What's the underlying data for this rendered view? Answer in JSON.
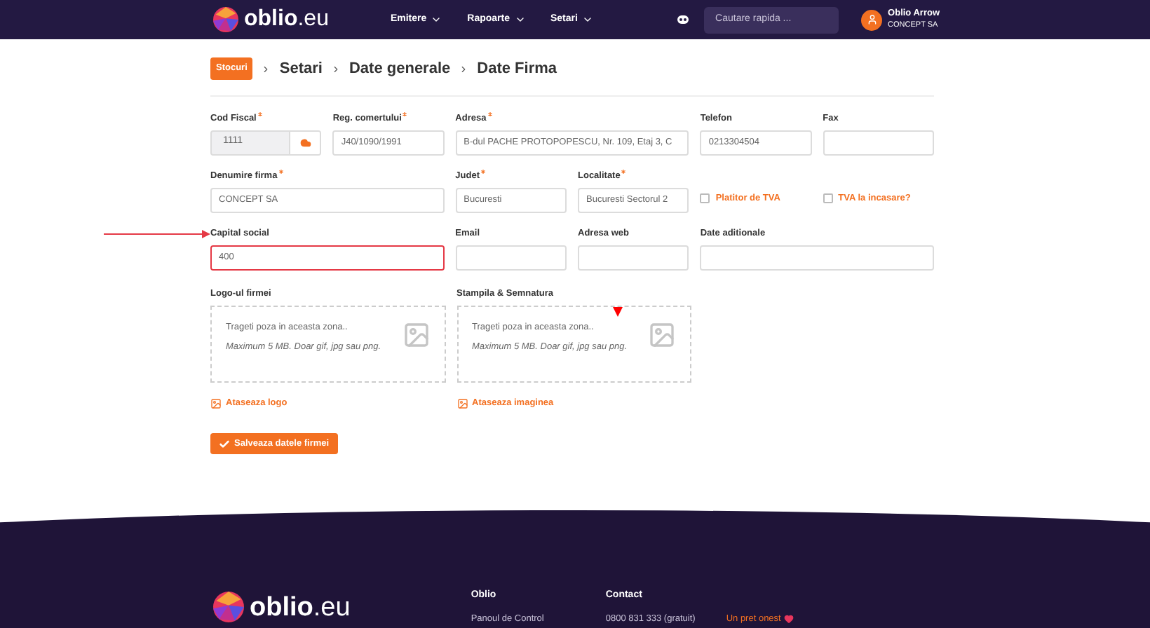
{
  "header": {
    "logo": "oblio.eu",
    "nav": [
      {
        "label": "Emitere"
      },
      {
        "label": "Rapoarte"
      },
      {
        "label": "Setari"
      }
    ],
    "search": {
      "placeholder": "Cautare rapida ..."
    },
    "user": {
      "name": "Oblio Arrow",
      "company": "CONCEPT SA"
    }
  },
  "breadcrumb": {
    "badge": "Stocuri",
    "items": [
      "Setari",
      "Date generale",
      "Date Firma"
    ]
  },
  "form_rows": [
    [
      {
        "kind": "input_button",
        "label": "Cod Fiscal",
        "required": true,
        "value": "1111",
        "disabled": true
      },
      {
        "kind": "input",
        "label": "Reg. comertului",
        "required": true,
        "value": "J40/1090/1991"
      },
      {
        "kind": "input",
        "label": "Adresa",
        "required": true,
        "value": "B-dul PACHE PROTOPOPESCU, Nr. 109, Etaj 3, C"
      },
      {
        "kind": "input",
        "label": "Telefon",
        "required": false,
        "value": "0213304504"
      },
      {
        "kind": "input",
        "label": "Fax",
        "required": false
      }
    ],
    [
      {
        "kind": "input",
        "label": "Denumire firma",
        "required": true,
        "value": "CONCEPT SA"
      },
      {
        "kind": "input",
        "label": "Judet",
        "required": true,
        "value": "Bucuresti"
      },
      {
        "kind": "input",
        "label": "Localitate",
        "required": true,
        "value": "Bucuresti Sectorul 2"
      },
      {
        "kind": "checkbox",
        "label": "Platitor de TVA",
        "checked": false
      },
      {
        "kind": "checkbox",
        "label": "TVA la incasare?",
        "checked": false
      }
    ],
    [
      {
        "kind": "input",
        "label": "Capital social",
        "required": false,
        "value": "400",
        "highlighted": true
      },
      {
        "kind": "input",
        "label": "Email",
        "required": false
      },
      {
        "kind": "input",
        "label": "Adresa web",
        "required": false
      },
      {
        "kind": "input",
        "label": "Date aditionale",
        "required": false
      }
    ]
  ],
  "uploads": [
    {
      "label": "Logo-ul firmei",
      "hint": "Trageti poza in aceasta zona..",
      "note": "Maximum 5 MB. Doar gif, jpg sau png.",
      "link": "Ataseaza logo"
    },
    {
      "label": "Stampila & Semnatura",
      "hint": "Trageti poza in aceasta zona..",
      "note": "Maximum 5 MB. Doar gif, jpg sau png.",
      "link": "Ataseaza imaginea"
    }
  ],
  "save_button": "Salveaza datele firmei",
  "footer": {
    "logo": "oblio.eu",
    "columns": [
      {
        "title": "Oblio",
        "links": [
          "Panoul de Control"
        ]
      },
      {
        "title": "Contact",
        "links": [
          "0800 831 333 (gratuit)"
        ]
      }
    ],
    "tagline": "Un pret onest"
  }
}
